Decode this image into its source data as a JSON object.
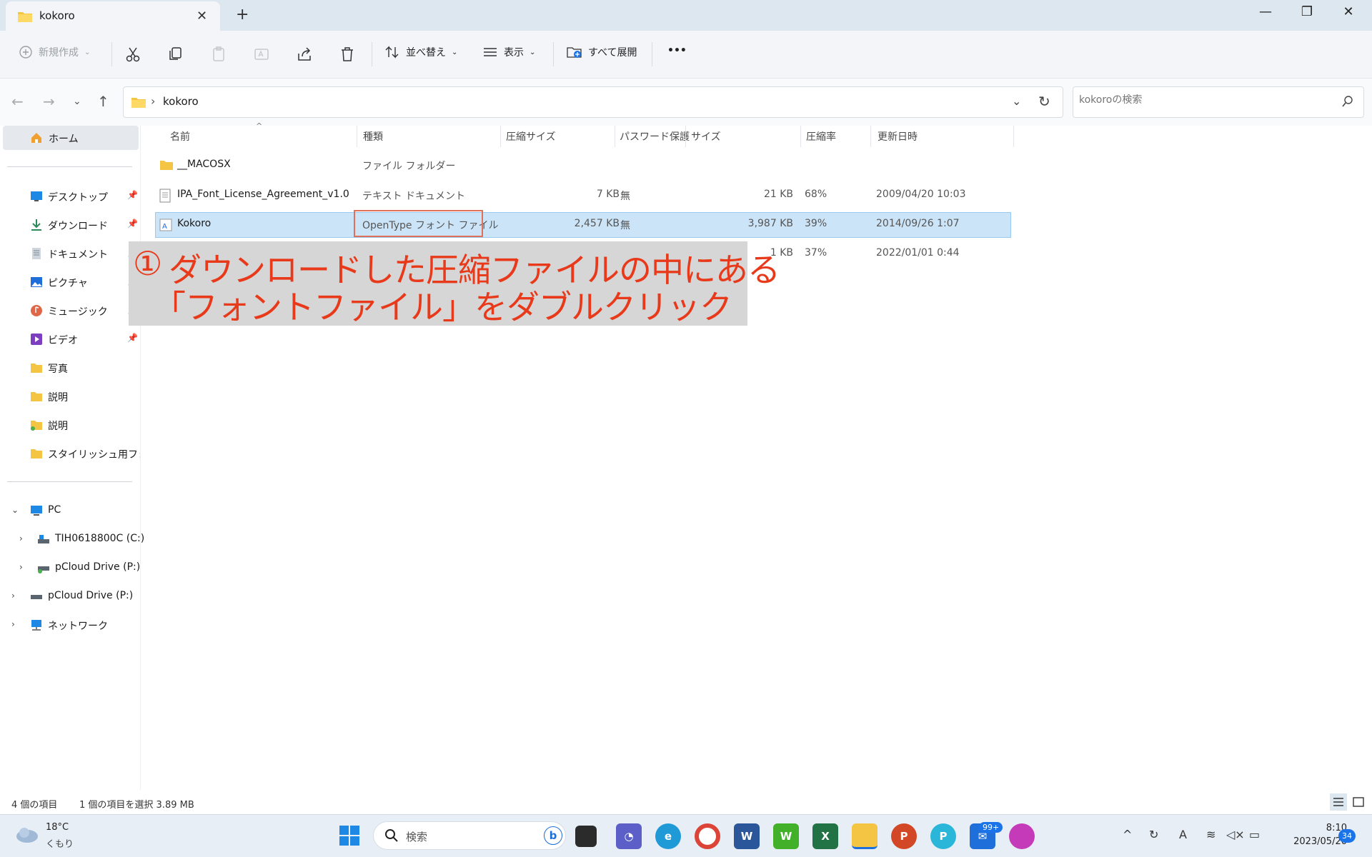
{
  "window": {
    "tab_title": "kokoro",
    "new_tab": "+",
    "close_tab": "✕",
    "minimize": "—",
    "maximize": "❐",
    "close": "✕"
  },
  "toolbar": {
    "new": "新規作成",
    "sort": "並べ替え",
    "view": "表示",
    "expand_all": "すべて展開",
    "more": "•••"
  },
  "address": {
    "crumb": "kokoro",
    "search_placeholder": "kokoroの検索"
  },
  "sidebar": {
    "home": "ホーム",
    "quick": [
      {
        "label": "デスクトップ",
        "icon": "desktop-icon"
      },
      {
        "label": "ダウンロード",
        "icon": "download-icon"
      },
      {
        "label": "ドキュメント",
        "icon": "document-icon"
      },
      {
        "label": "ピクチャ",
        "icon": "pictures-icon"
      },
      {
        "label": "ミュージック",
        "icon": "music-icon"
      },
      {
        "label": "ビデオ",
        "icon": "video-icon"
      },
      {
        "label": "写真",
        "icon": "folder-icon"
      },
      {
        "label": "説明",
        "icon": "folder-icon"
      },
      {
        "label": "説明",
        "icon": "folder-icon"
      },
      {
        "label": "スタイリッシュ用フォント",
        "icon": "folder-icon"
      }
    ],
    "pc": "PC",
    "drives": [
      {
        "label": "TIH0618800C (C:)"
      },
      {
        "label": "pCloud Drive (P:)"
      },
      {
        "label": "pCloud Drive (P:)"
      }
    ],
    "network": "ネットワーク"
  },
  "columns": {
    "name": "名前",
    "type": "種類",
    "compressed": "圧縮サイズ",
    "password": "パスワード保護",
    "size": "サイズ",
    "ratio": "圧縮率",
    "modified": "更新日時"
  },
  "files": [
    {
      "name": "__MACOSX",
      "type": "ファイル フォルダー",
      "compressed": "",
      "password": "",
      "size": "",
      "ratio": "",
      "modified": ""
    },
    {
      "name": "IPA_Font_License_Agreement_v1.0",
      "type": "テキスト ドキュメント",
      "compressed": "7 KB",
      "password": "無",
      "size": "21 KB",
      "ratio": "68%",
      "modified": "2009/04/20 10:03"
    },
    {
      "name": "Kokoro",
      "type": "OpenType フォント ファイル",
      "compressed": "2,457 KB",
      "password": "無",
      "size": "3,987 KB",
      "ratio": "39%",
      "modified": "2014/09/26 1:07"
    },
    {
      "name": "",
      "type": "",
      "compressed": "",
      "password": "",
      "size": "1 KB",
      "ratio": "37%",
      "modified": "2022/01/01 0:44"
    }
  ],
  "annotation": {
    "num": "①",
    "line1": "ダウンロードした圧縮ファイルの中にある",
    "line2": "「フォントファイル」をダブルクリック"
  },
  "status": {
    "count": "4 個の項目",
    "selected": "1 個の項目を選択  3.89 MB"
  },
  "taskbar": {
    "weather_temp": "18°C",
    "weather_desc": "くもり",
    "search": "検索",
    "mail_badge": "99+",
    "time": "8:10",
    "date": "2023/05/20",
    "notif_badge": "34"
  }
}
